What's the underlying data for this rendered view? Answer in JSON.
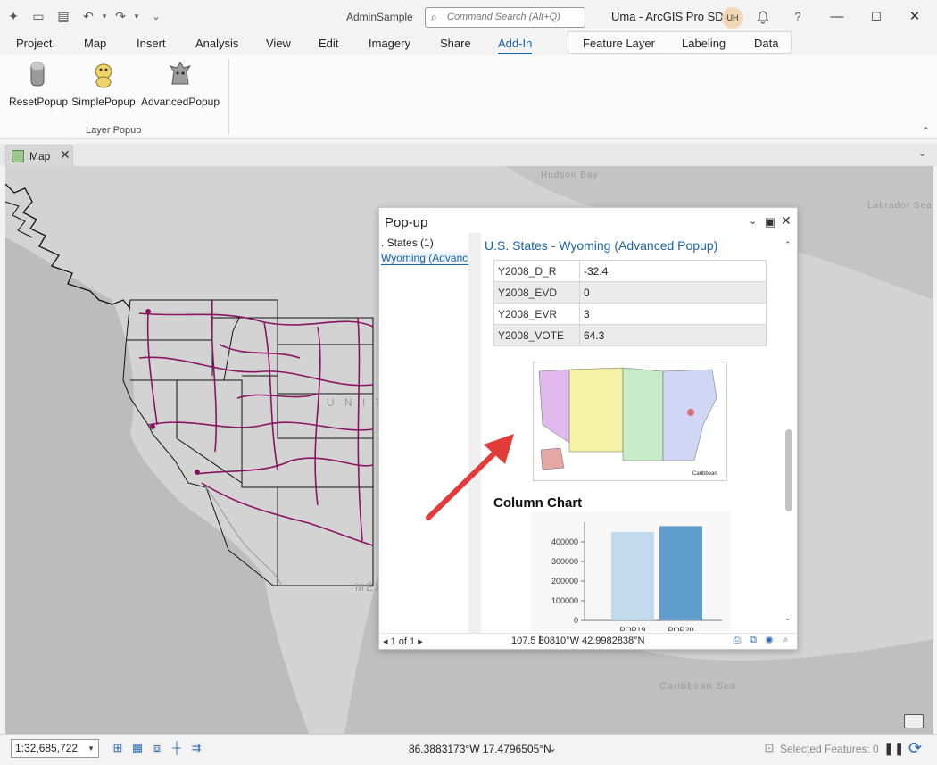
{
  "titlebar": {
    "doc_title": "AdminSample",
    "search_placeholder": "Command Search (Alt+Q)",
    "app_title": "Uma - ArcGIS Pro SDK",
    "avatar_initials": "UH",
    "help": "?",
    "minimize": "—",
    "maximize": "☐",
    "close": "✕"
  },
  "ribbon": {
    "tabs": [
      "Project",
      "Map",
      "Insert",
      "Analysis",
      "View",
      "Edit",
      "Imagery",
      "Share",
      "Add-In"
    ],
    "active_tab": "Add-In",
    "context_tabs": [
      "Feature Layer",
      "Labeling",
      "Data"
    ],
    "buttons": [
      "ResetPopup",
      "SimplePopup",
      "AdvancedPopup"
    ],
    "group_label": "Layer Popup"
  },
  "view": {
    "map_tab": "Map"
  },
  "map_labels": {
    "hudson_bay": "Hudson Bay",
    "labrador_sea": "Labrador Sea",
    "united_states": "U N I T",
    "mexico": "MÉX",
    "caribbean_sea": "Caribbean Sea"
  },
  "popup": {
    "title": "Pop-up",
    "left_items": [
      ". States (1)",
      "Wyoming (Advanced Popup)"
    ],
    "header": "U.S. States - Wyoming (Advanced Popup)",
    "attributes": [
      {
        "key": "Y2008_D_R",
        "value": "-32.4"
      },
      {
        "key": "Y2008_EVD",
        "value": "0"
      },
      {
        "key": "Y2008_EVR",
        "value": "3"
      },
      {
        "key": "Y2008_VOTE",
        "value": "64.3"
      }
    ],
    "map_caption": "Caribbean",
    "chart_title": "Column Chart",
    "nav": "1 of 1",
    "coords": "107.5 30810°W 42.9982838°N"
  },
  "chart_data": {
    "type": "bar",
    "categories": [
      "POP19",
      "POP20"
    ],
    "values": [
      450000,
      480000
    ],
    "ylim": [
      0,
      500000
    ],
    "yticks": [
      0,
      100000,
      200000,
      300000,
      400000
    ],
    "colors": [
      "#c2dbec",
      "#5e9dcc"
    ],
    "title": "Column Chart"
  },
  "statusbar": {
    "scale": "1:32,685,722",
    "coords": "86.3883173°W 17.4796505°N",
    "selected": "Selected Features: 0"
  }
}
